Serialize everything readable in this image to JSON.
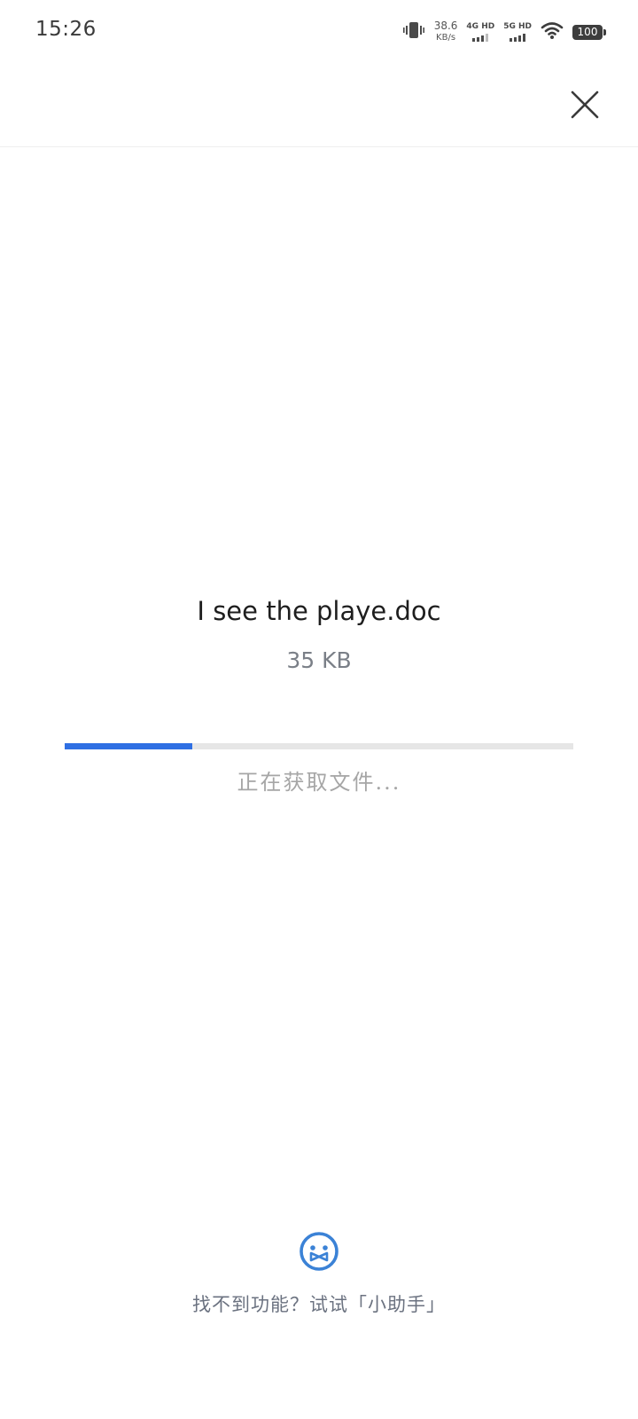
{
  "status_bar": {
    "time": "15:26",
    "net_speed_value": "38.6",
    "net_speed_unit": "KB/s",
    "network_1": "4G HD",
    "network_2": "5G HD",
    "battery": "100",
    "icons": [
      "vibrate-icon",
      "signal-icon",
      "wifi-icon",
      "battery-icon"
    ]
  },
  "header": {
    "close_icon": "close-icon"
  },
  "file": {
    "name": "I see the playe.doc",
    "size": "35 KB"
  },
  "progress": {
    "fraction": 0.25,
    "status_text": "正在获取文件...",
    "fill_color": "#2f6fe3",
    "track_color": "#e6e6e6"
  },
  "assistant": {
    "icon": "assistant-robot-icon",
    "link_text": "找不到功能？试试「小助手」",
    "icon_color": "#3b82d6"
  }
}
